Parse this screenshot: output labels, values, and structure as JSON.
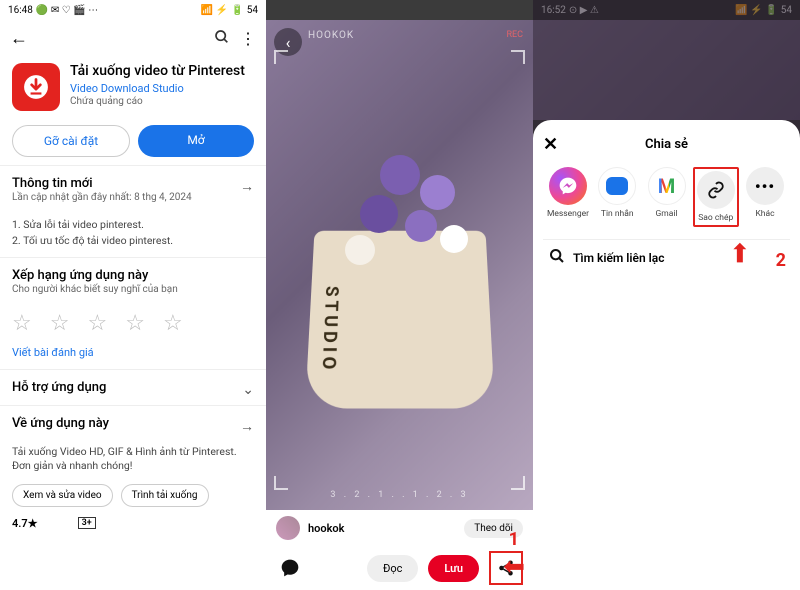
{
  "panel1": {
    "status_time": "16:48",
    "status_batt": "54",
    "app_name": "Tải xuống video từ Pinterest",
    "developer": "Video Download Studio",
    "ads_label": "Chứa quảng cáo",
    "uninstall": "Gỡ cài đặt",
    "open": "Mở",
    "whatsnew_title": "Thông tin mới",
    "whatsnew_sub": "Lần cập nhật gần đây nhất: 8 thg 4, 2024",
    "note1": "1. Sửa lỗi tải video pinterest.",
    "note2": "2. Tối ưu tốc độ tải video pinterest.",
    "rate_title": "Xếp hạng ứng dụng này",
    "rate_sub": "Cho người khác biết suy nghĩ của bạn",
    "write_review": "Viết bài đánh giá",
    "support": "Hỗ trợ ứng dụng",
    "about": "Về ứng dụng này",
    "about_desc": "Tải xuống Video HD, GIF & Hình ảnh từ Pinterest. Đơn giản và nhanh chóng!",
    "chip1": "Xem và sửa video",
    "chip2": "Trình tải xuống",
    "rating_value": "4.7★",
    "rating_box": "3+"
  },
  "panel2": {
    "watermark": "HOOKOK",
    "rec": "REC",
    "studio_label": "STUDIO",
    "counter": "3 . 2 . 1 .     . 1 . 2 . 3",
    "username": "hookok",
    "follow": "Theo dõi",
    "read": "Đọc",
    "save": "Lưu",
    "step": "1"
  },
  "panel3": {
    "status_time": "16:52",
    "status_batt": "54",
    "sheet_title": "Chia sẻ",
    "icons": {
      "messenger": "Messenger",
      "messages": "Tin nhắn",
      "gmail": "Gmail",
      "copy": "Sao chép",
      "more": "Khác"
    },
    "search_contacts": "Tìm kiếm liên lạc",
    "step": "2"
  }
}
